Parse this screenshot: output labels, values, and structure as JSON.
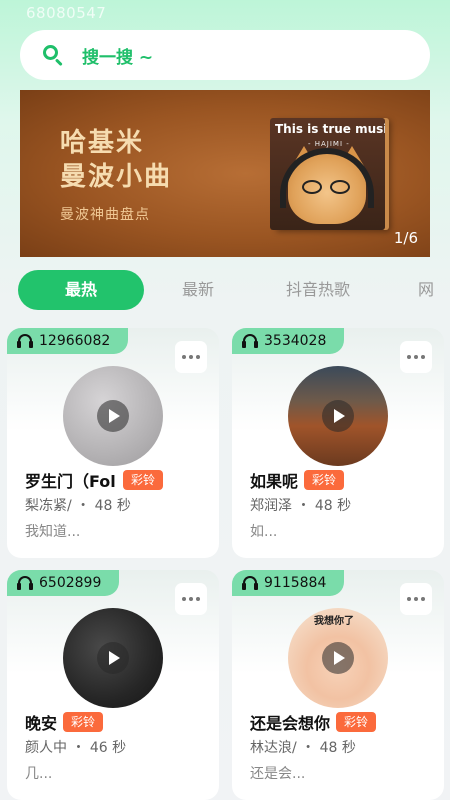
{
  "status": {
    "device_id": "68080547"
  },
  "search": {
    "placeholder": "搜一搜 ~"
  },
  "banner": {
    "title_line1": "哈基米",
    "title_line2": "曼波小曲",
    "subtitle": "曼波神曲盘点",
    "album_title": "This is true music",
    "album_subtitle": "- HAJIMI -",
    "pager": "1/6"
  },
  "tabs": [
    {
      "label": "最热",
      "active": true
    },
    {
      "label": "最新",
      "active": false
    },
    {
      "label": "抖音热歌",
      "active": false
    },
    {
      "label": "网",
      "active": false
    }
  ],
  "ring_label": "彩铃",
  "cards": [
    {
      "plays": "12966082",
      "title": "罗生门（Foll",
      "meta": "梨冻紧/ ・ 48 秒",
      "lyric": "我知道...",
      "cover_color": "#b8b6b8"
    },
    {
      "plays": "3534028",
      "title": "如果呢",
      "meta": "郑润泽 ・ 48 秒",
      "lyric": "如...",
      "cover_color": "#7d4a2c"
    },
    {
      "plays": "6502899",
      "title": "晚安",
      "meta": "颜人中 ・ 46 秒",
      "lyric": "几...",
      "cover_color": "#2a2a2a"
    },
    {
      "plays": "9115884",
      "title": "还是会想你",
      "meta": "林达浪/ ・ 48 秒",
      "lyric": "还是会...",
      "cover_color": "#f3d9c6",
      "cover_text": "我想你了"
    }
  ]
}
